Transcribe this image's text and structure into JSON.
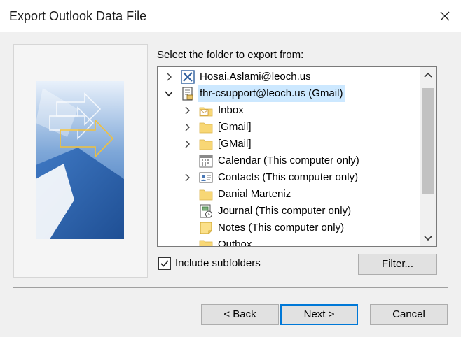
{
  "window": {
    "title": "Export Outlook Data File"
  },
  "prompt": "Select the folder to export from:",
  "tree": {
    "items": [
      {
        "label": "Hosai.Aslami@leoch.us",
        "icon": "exchange-account-icon",
        "expander": "collapsed",
        "selected": false
      },
      {
        "label": "fhr-csupport@leoch.us (Gmail)",
        "icon": "data-file-icon",
        "expander": "expanded",
        "selected": true
      },
      {
        "label": "Inbox",
        "icon": "inbox-folder-icon",
        "expander": "collapsed",
        "selected": false
      },
      {
        "label": "[Gmail]",
        "icon": "folder-icon",
        "expander": "collapsed",
        "selected": false
      },
      {
        "label": "[GMail]",
        "icon": "folder-icon",
        "expander": "collapsed",
        "selected": false
      },
      {
        "label": "Calendar (This computer only)",
        "icon": "calendar-icon",
        "expander": "none",
        "selected": false
      },
      {
        "label": "Contacts (This computer only)",
        "icon": "contacts-icon",
        "expander": "collapsed",
        "selected": false
      },
      {
        "label": "Danial Marteniz",
        "icon": "folder-icon",
        "expander": "none",
        "selected": false
      },
      {
        "label": "Journal (This computer only)",
        "icon": "journal-icon",
        "expander": "none",
        "selected": false
      },
      {
        "label": "Notes (This computer only)",
        "icon": "notes-icon",
        "expander": "none",
        "selected": false
      },
      {
        "label": "Outbox",
        "icon": "folder-icon",
        "expander": "none",
        "selected": false
      }
    ]
  },
  "include_subfolders": {
    "label": "Include subfolders",
    "checked": true
  },
  "buttons": {
    "filter": "Filter...",
    "back": "< Back",
    "next": "Next >",
    "cancel": "Cancel"
  },
  "colors": {
    "selection": "#cce8ff",
    "default_button_border": "#0078d7",
    "folder_yellow": "#f8d775"
  }
}
